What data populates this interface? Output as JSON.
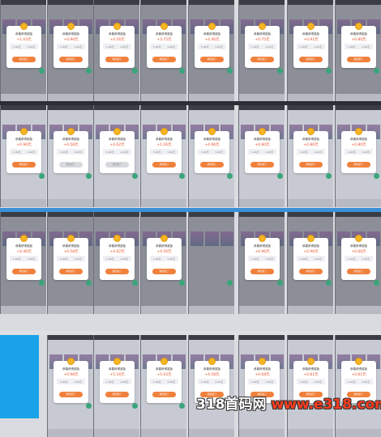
{
  "modal": {
    "title": "恭喜获得奖励",
    "button_label": "我知道了",
    "row_left": "1.00元",
    "row_right": "1.00元"
  },
  "amounts": [
    "+1.03元",
    "+0.96元",
    "+4.56元",
    "+3.75元",
    "+4.46元",
    "+0.75元",
    "+0.91元",
    "+0.80元",
    "+0.96元",
    "+4.58元",
    "+4.62元",
    "+1.26元",
    "+4.96元",
    "+0.80元",
    "+0.86元",
    "+0.80元",
    "+4.46元",
    "+0.58元",
    "+4.62元",
    "+4.56元",
    "",
    "+0.96元",
    "+0.96元",
    "+0.66元",
    "",
    "+0.98元",
    "+5.16元",
    "+5.03元",
    "+4.58元",
    "+0.68元",
    "+0.81元",
    "+0.81元"
  ],
  "watermark": {
    "brand": "318首码网",
    "url": "www.e318.com"
  }
}
